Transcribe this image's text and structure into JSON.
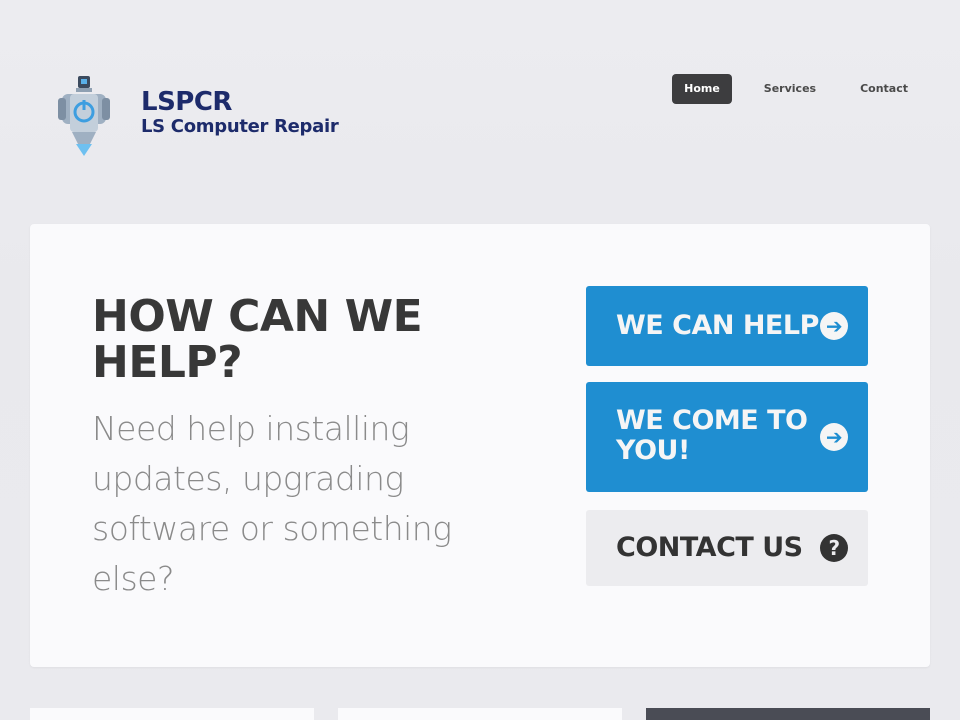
{
  "brand": {
    "title": "LSPCR",
    "subtitle": "LS Computer Repair",
    "logo_icon": "power-robot-icon",
    "color": "#1d2b6b"
  },
  "nav": {
    "items": [
      {
        "label": "Home",
        "active": true
      },
      {
        "label": "Services",
        "active": false
      },
      {
        "label": "Contact",
        "active": false
      }
    ]
  },
  "hero": {
    "heading": "HOW CAN WE HELP?",
    "text": "Need help installing updates, upgrading software or something else?"
  },
  "actions": {
    "help": {
      "label": "WE CAN HELP",
      "icon": "arrow-right-circle-icon"
    },
    "come": {
      "label": "WE COME TO YOU!",
      "icon": "arrow-right-circle-icon"
    },
    "contact": {
      "label": "CONTACT US",
      "icon": "question-circle-icon"
    }
  },
  "colors": {
    "accent": "#1f8ed1",
    "nav_active": "#3d3d3f",
    "heading": "#383838"
  }
}
